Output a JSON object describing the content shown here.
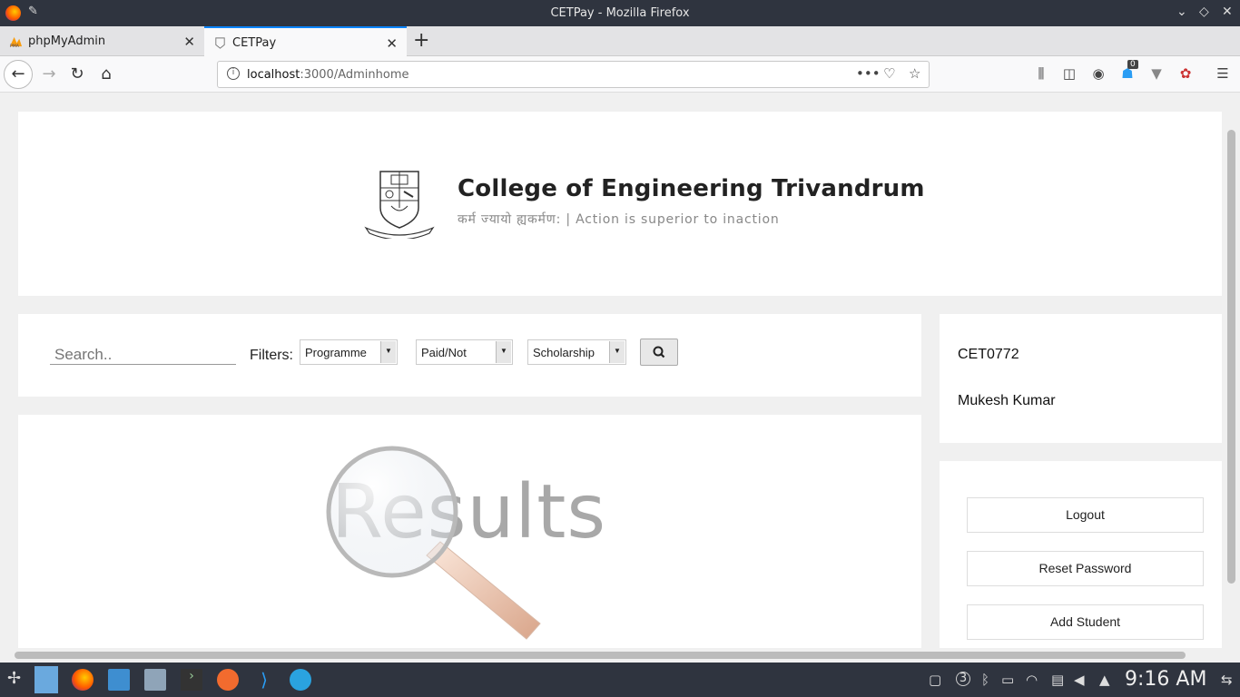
{
  "window": {
    "title": "CETPay - Mozilla Firefox"
  },
  "tabs": [
    {
      "label": "phpMyAdmin"
    },
    {
      "label": "CETPay"
    }
  ],
  "url": {
    "host": "localhost",
    "path": ":3000/Adminhome"
  },
  "header": {
    "college": "College of Engineering Trivandrum",
    "motto": "कर्म ज्यायो ह्यकर्मण: | Action is superior to inaction"
  },
  "filters": {
    "search_placeholder": "Search..",
    "label": "Filters:",
    "programme": "Programme",
    "paid": "Paid/Not",
    "scholarship": "Scholarship"
  },
  "user": {
    "id": "CET0772",
    "name": "Mukesh Kumar"
  },
  "actions": {
    "logout": "Logout",
    "reset": "Reset Password",
    "add": "Add Student"
  },
  "results": {
    "label": "Results"
  },
  "taskbar": {
    "clock": "9:16 AM",
    "badge": "0",
    "workspace": "3"
  }
}
